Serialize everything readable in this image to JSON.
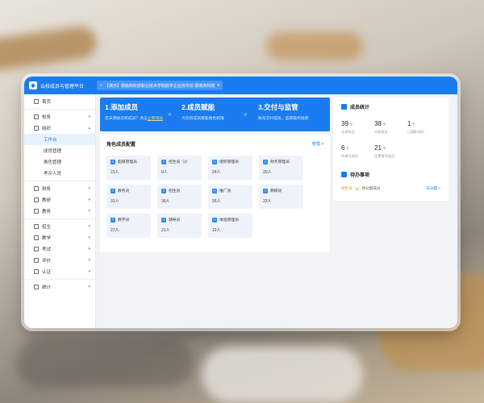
{
  "app": {
    "title": "云校成员与管理平台",
    "org_select": "【演示】鄂南商科技职业技术学院鼎宇企业协作云-鄂南商科技"
  },
  "sidebar": {
    "home": "首页",
    "sections": [
      {
        "label": "校务",
        "expanded": false
      },
      {
        "label": "组织",
        "expanded": true,
        "children": [
          "工作台",
          "成员管理",
          "角色管理",
          "考评人员"
        ]
      }
    ],
    "groups": [
      "财务",
      "教研",
      "教务",
      "招生",
      "教学",
      "考试",
      "评价",
      "认证",
      "统计"
    ],
    "active_item": "工作台"
  },
  "banner": {
    "steps": [
      {
        "title": "1.添加成员",
        "desc": "还未添加云校成员？点击",
        "link": "立即添加"
      },
      {
        "title": "2.成员赋能",
        "desc": "为云校成员赋能角色权限",
        "link": ""
      },
      {
        "title": "3.交付与监管",
        "desc": "账号交付成员，监管操作指南",
        "link": ""
      }
    ]
  },
  "roles": {
    "title": "角色成员配置",
    "more": "管理 >",
    "items": [
      {
        "name": "超级管理员",
        "count": "21人"
      },
      {
        "name": "招生员（2）",
        "count": "0人"
      },
      {
        "name": "组织管理员",
        "count": "24人"
      },
      {
        "name": "财务管理员",
        "count": "20人"
      },
      {
        "name": "教务员",
        "count": "31人"
      },
      {
        "name": "招生员",
        "count": "30人"
      },
      {
        "name": "推广员",
        "count": "26人"
      },
      {
        "name": "教研员",
        "count": "23人"
      },
      {
        "name": "教学员",
        "count": "27人"
      },
      {
        "name": "辅导员",
        "count": "21人"
      },
      {
        "name": "体验管理员",
        "count": "12人"
      }
    ]
  },
  "stats": {
    "title": "成员统计",
    "unit": "个",
    "items": [
      {
        "value": "39",
        "label": "全部成员"
      },
      {
        "value": "38",
        "label": "在职成员"
      },
      {
        "value": "1",
        "label": "已离职成员"
      },
      {
        "value": "6",
        "label": "待激活成员"
      },
      {
        "value": "21",
        "label": "设置角色成员"
      }
    ]
  },
  "todo": {
    "title": "待办事项",
    "tag": "招生员",
    "count": "(2)",
    "text": "待分配成员",
    "link": "去分配 >"
  }
}
